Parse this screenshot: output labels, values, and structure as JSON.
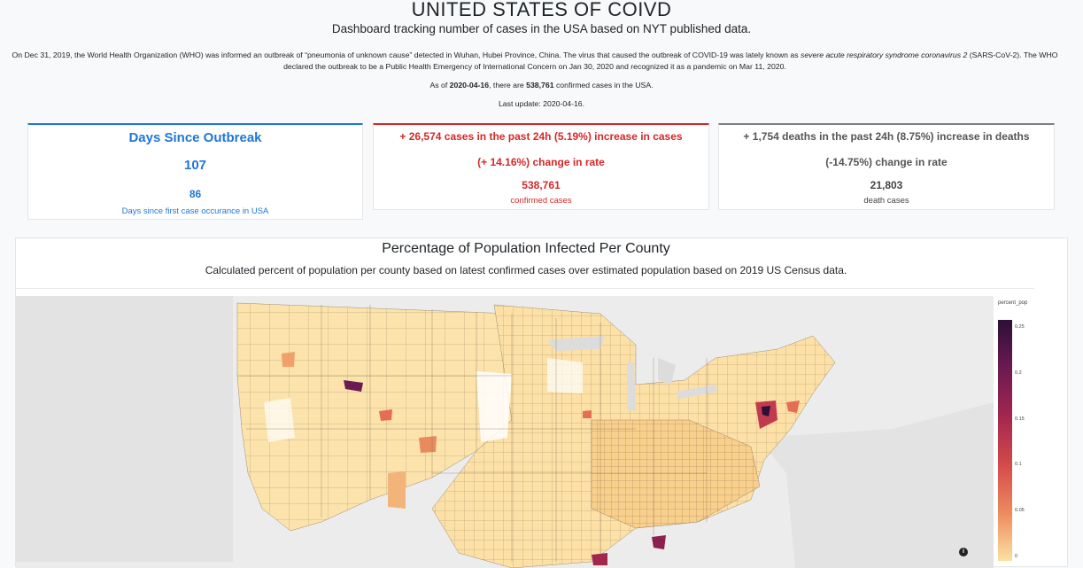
{
  "header": {
    "title": "UNITED STATES OF COIVD",
    "subtitle": "Dashboard tracking number of cases in the USA based on NYT published data."
  },
  "intro": {
    "part1": "On Dec 31, 2019, the World Health Organization (WHO) was informed an outbreak of “pneumonia of unknown cause” detected in Wuhan, Hubei Province, China. The virus that caused the outbreak of COVID-19 was lately known as ",
    "virus_name": "severe acute respiratory syndrome coronavirus 2",
    "part2": " (SARS-CoV-2). The WHO declared the outbreak to be a Public Health Emergency of International Concern on Jan 30, 2020 and recognized it as a pandemic on Mar 11, 2020.",
    "asof_prefix": "As of ",
    "asof_date": "2020-04-16",
    "asof_mid": ", there are ",
    "asof_count": "538,761",
    "asof_suffix": " confirmed cases in the USA.",
    "last_update": "Last update: 2020-04-16."
  },
  "cards": {
    "days": {
      "title": "Days Since Outbreak",
      "value": "107",
      "first_case_value": "86",
      "first_case_label": "Days since first case occurance in USA"
    },
    "cases": {
      "title": "+ 26,574 cases in the past 24h (5.19%) increase in cases",
      "rate": "(+ 14.16%) change in rate",
      "value": "538,761",
      "label": "confirmed cases"
    },
    "deaths": {
      "title": "+ 1,754 deaths in the past 24h (8.75%) increase in deaths",
      "rate": "(-14.75%) change in rate",
      "value": "21,803",
      "label": "death cases"
    }
  },
  "map": {
    "title": "Percentage of Population Infected Per County",
    "description": "Calculated percent of population per county based on latest confirmed cases over estimated population based on 2019 US Census data.",
    "legend_title": "percent_pop",
    "legend_ticks": [
      "0.25",
      "0.2",
      "0.15",
      "0.1",
      "0.05",
      "0"
    ],
    "colorscale": [
      "#fbe1a4",
      "#ee8a5d",
      "#d44a4a",
      "#a3264f",
      "#6b1a52",
      "#2d0f38"
    ]
  },
  "colors": {
    "blue": "#1f77d4",
    "red": "#d62728",
    "gray": "#7f7f7f"
  }
}
